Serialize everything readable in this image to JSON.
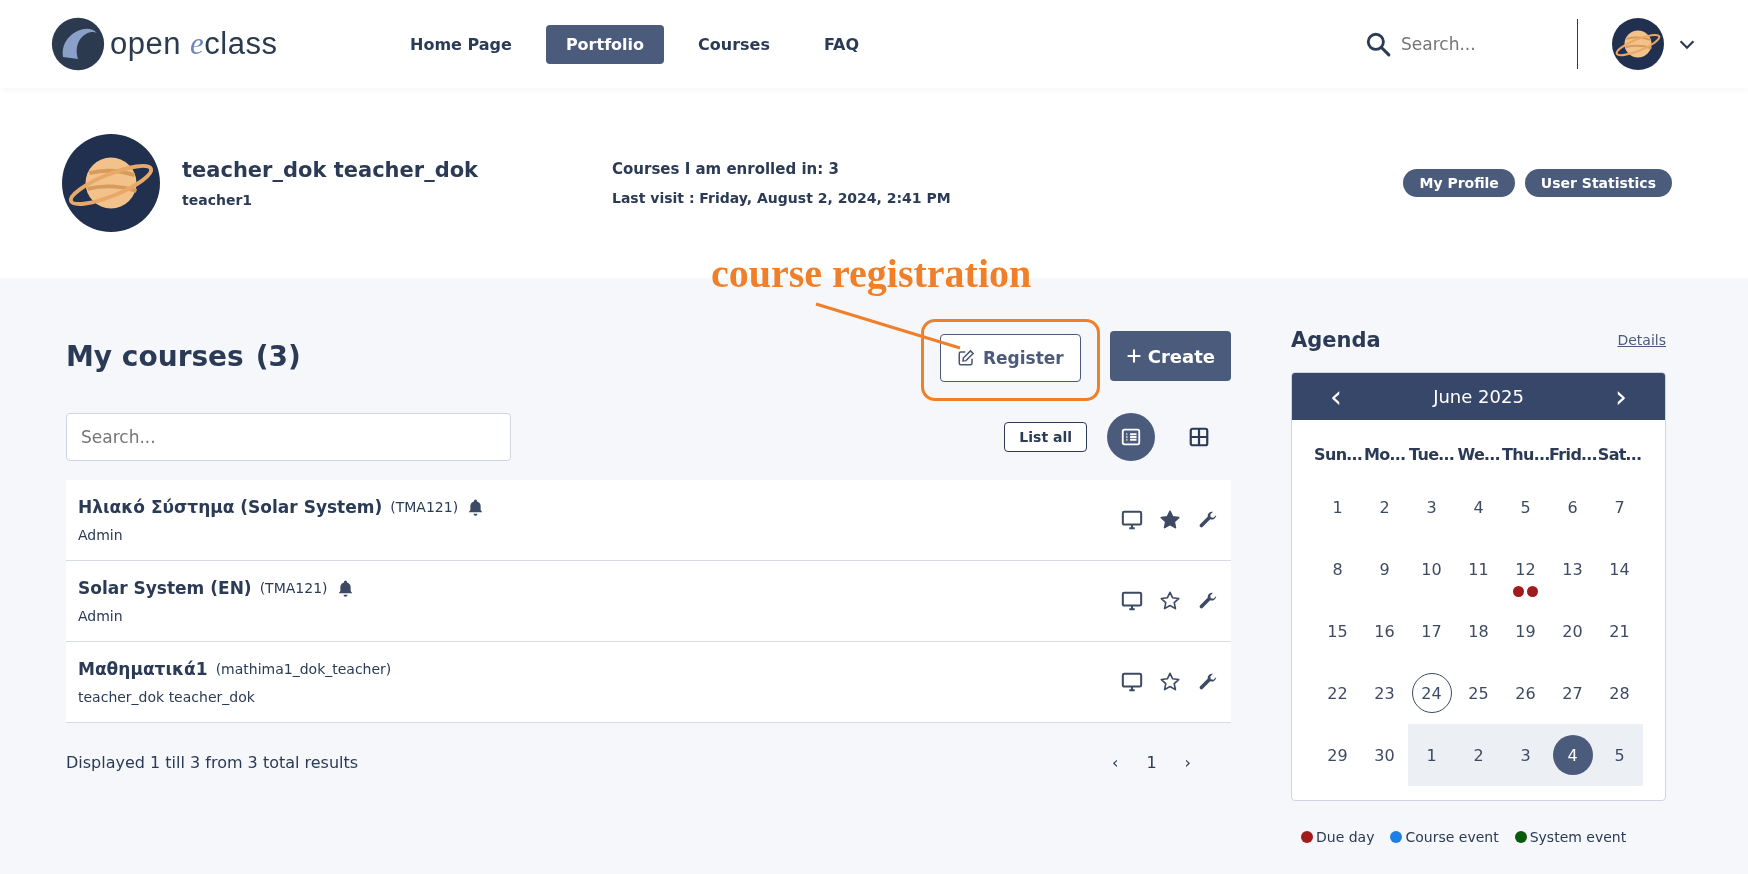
{
  "header": {
    "logo": {
      "before": "open",
      "accent": "e",
      "after": "class"
    },
    "nav": [
      {
        "label": "Home Page",
        "selected": false
      },
      {
        "label": "Portfolio",
        "selected": true
      },
      {
        "label": "Courses",
        "selected": false
      },
      {
        "label": "FAQ",
        "selected": false
      }
    ],
    "search": {
      "placeholder": "Search..."
    }
  },
  "profile": {
    "name": "teacher_dok teacher_dok",
    "username": "teacher1",
    "enrolled": "Courses I am enrolled in: 3",
    "last_visit": "Last visit : Friday, August 2, 2024, 2:41 PM",
    "buttons": [
      "My Profile",
      "User Statistics"
    ]
  },
  "annotation": {
    "text": "course registration"
  },
  "courses": {
    "title": "My courses",
    "count": "(3)",
    "register": "Register",
    "create": "Create",
    "search": {
      "placeholder": "Search..."
    },
    "list_all": "List all",
    "views": [
      {
        "kind": "list",
        "selected": true
      },
      {
        "kind": "grid",
        "selected": false
      }
    ],
    "rows": [
      {
        "title": "Ηλιακό Σύστημα (Solar System)",
        "code": "(TMA121)",
        "notifications": true,
        "teacher": "Admin",
        "favorite": true
      },
      {
        "title": "Solar System (EN)",
        "code": "(TMA121)",
        "notifications": true,
        "teacher": "Admin",
        "favorite": false
      },
      {
        "title": "Μαθηματικά1",
        "code": "(mathima1_dok_teacher)",
        "notifications": false,
        "teacher": "teacher_dok teacher_dok",
        "favorite": false
      }
    ],
    "summary": "Displayed 1 till 3 from 3 total results",
    "pagination": {
      "prev": "‹",
      "pages": [
        "1"
      ],
      "next": "›"
    }
  },
  "agenda": {
    "title": "Agenda",
    "details": "Details",
    "calendar": {
      "prev": "‹",
      "month": "June 2025",
      "next": "›",
      "weekdays": [
        "Sun…",
        "Mo…",
        "Tue…",
        "We…",
        "Thu…",
        "Frid…",
        "Sat…"
      ],
      "weeks": [
        [
          {
            "label": "1"
          },
          {
            "label": "2"
          },
          {
            "label": "3"
          },
          {
            "label": "4"
          },
          {
            "label": "5"
          },
          {
            "label": "6"
          },
          {
            "label": "7"
          }
        ],
        [
          {
            "label": "8"
          },
          {
            "label": "9"
          },
          {
            "label": "10"
          },
          {
            "label": "11"
          },
          {
            "label": "12",
            "events": [
              {
                "color": "#a01c1c"
              },
              {
                "color": "#a01c1c"
              }
            ]
          },
          {
            "label": "13"
          },
          {
            "label": "14"
          }
        ],
        [
          {
            "label": "15"
          },
          {
            "label": "16"
          },
          {
            "label": "17"
          },
          {
            "label": "18"
          },
          {
            "label": "19"
          },
          {
            "label": "20"
          },
          {
            "label": "21"
          }
        ],
        [
          {
            "label": "22"
          },
          {
            "label": "23"
          },
          {
            "label": "24",
            "today": true
          },
          {
            "label": "25"
          },
          {
            "label": "26"
          },
          {
            "label": "27"
          },
          {
            "label": "28"
          }
        ],
        [
          {
            "label": "29"
          },
          {
            "label": "30"
          },
          {
            "label": "1",
            "other_month": true
          },
          {
            "label": "2",
            "other_month": true
          },
          {
            "label": "3",
            "other_month": true
          },
          {
            "label": "4",
            "other_month": true,
            "selected": true
          },
          {
            "label": "5",
            "other_month": true
          }
        ]
      ]
    },
    "legend": [
      {
        "label": "Due day",
        "color": "#a01c1c"
      },
      {
        "label": "Course event",
        "color": "#1e7ee6"
      },
      {
        "label": "System event",
        "color": "#0b5a0b"
      }
    ]
  }
}
